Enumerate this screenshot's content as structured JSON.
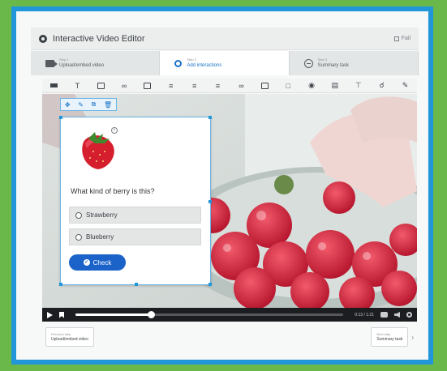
{
  "app": {
    "title": "Interactive Video Editor",
    "fullscreen_label": "Fail"
  },
  "step_tabs": [
    {
      "step": "Step 1",
      "label": "Upload/embed video",
      "icon": "video-camera-icon",
      "active": false
    },
    {
      "step": "Step 2",
      "label": "Add interactions",
      "icon": "pin-icon",
      "active": true
    },
    {
      "step": "Step 3",
      "label": "Summary task",
      "icon": "summary-icon",
      "active": false
    }
  ],
  "toolbar": {
    "tools": [
      "label-tool",
      "text-tool",
      "table-tool",
      "link-tool",
      "image-tool",
      "statements-tool",
      "single-choice-tool",
      "multiple-choice-tool",
      "true-false-tool",
      "fill-blanks-tool",
      "drag-text-tool",
      "mark-words-tool",
      "drag-drop-tool",
      "crossroads-tool",
      "navigation-hotspot-tool",
      "free-text-tool"
    ]
  },
  "interaction": {
    "question": "What kind of berry is this?",
    "options": [
      "Strawberry",
      "Blueberry"
    ],
    "check_label": "Check",
    "image_icon": "strawberry-image",
    "popup_tools": [
      "move-icon",
      "edit-icon",
      "copy-icon",
      "delete-icon"
    ]
  },
  "player": {
    "progress": 0.28,
    "time": "0:13 / 1:21"
  },
  "bottom_nav": {
    "previous_small": "Previous step",
    "previous_label": "Upload/embed video",
    "next_small": "Next step",
    "next_label": "Summary task"
  },
  "colors": {
    "frame_green": "#6ab84a",
    "frame_blue": "#2196d8",
    "accent": "#1c63c9"
  }
}
